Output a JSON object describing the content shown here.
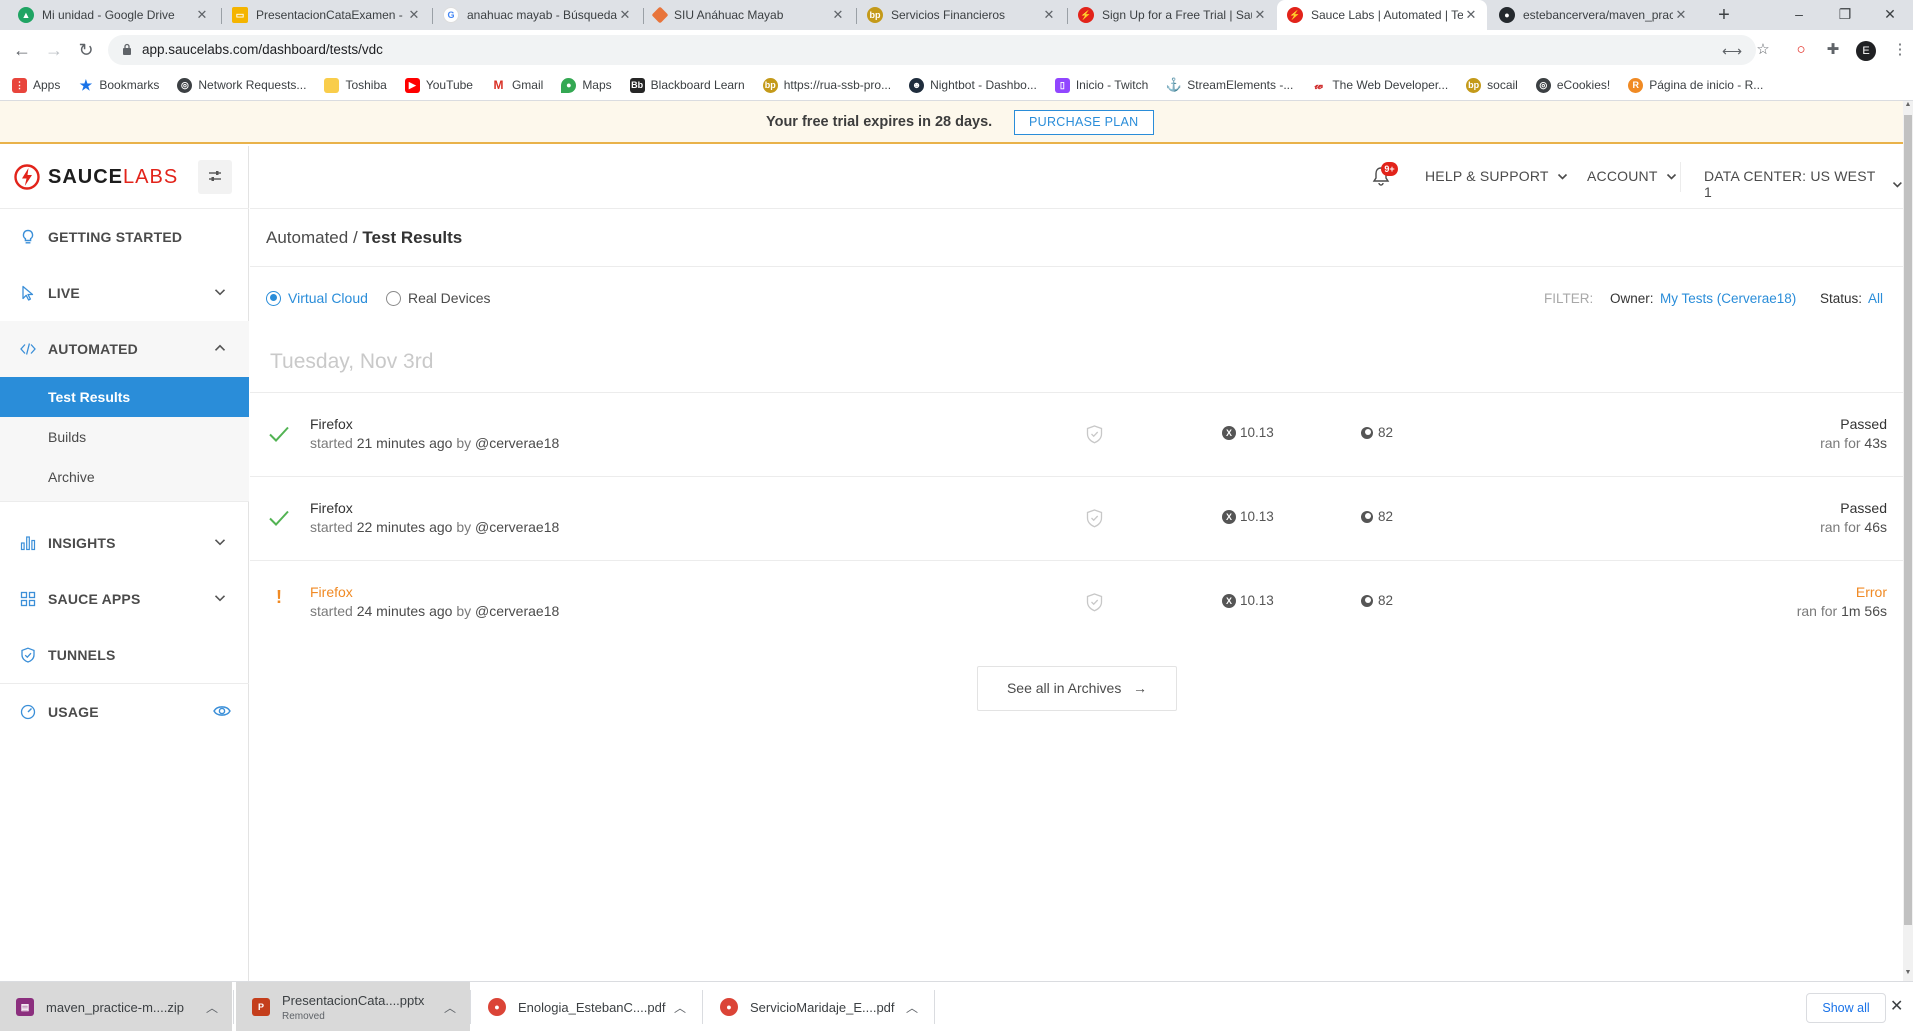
{
  "browser": {
    "tabs": [
      {
        "title": "Mi unidad - Google Drive",
        "icon": "google-drive-icon",
        "color": "#1fa463"
      },
      {
        "title": "PresentacionCataExamen - G",
        "icon": "slides-icon",
        "color": "#f4b400"
      },
      {
        "title": "anahuac mayab - Búsqueda",
        "icon": "google-icon",
        "color": "#4285f4"
      },
      {
        "title": "SIU Anáhuac Mayab",
        "icon": "siu-icon",
        "color": "#e8743b"
      },
      {
        "title": "Servicios Financieros",
        "icon": "bp-icon",
        "color": "#c49a1a"
      },
      {
        "title": "Sign Up for a Free Trial | Sau",
        "icon": "saucelabs-icon",
        "color": "#e2231a"
      },
      {
        "title": "Sauce Labs | Automated | Te",
        "icon": "saucelabs-icon",
        "color": "#e2231a"
      },
      {
        "title": "estebancervera/maven_prac",
        "icon": "github-icon",
        "color": "#24292e"
      }
    ],
    "new_tab": "+",
    "window_controls": [
      "–",
      "❐",
      "✕"
    ],
    "url": "app.saucelabs.com/dashboard/tests/vdc",
    "profile_initial": "E",
    "bookmarks": [
      {
        "label": "Apps",
        "icon": "apps-grid-icon",
        "color": "#e8453c"
      },
      {
        "label": "Bookmarks",
        "icon": "star-icon",
        "color": "#1a73e8"
      },
      {
        "label": "Network Requests...",
        "icon": "globe-icon",
        "color": "#3c4043"
      },
      {
        "label": "Toshiba",
        "icon": "folder-icon",
        "color": "#f9cd4b"
      },
      {
        "label": "YouTube",
        "icon": "youtube-icon",
        "color": "#ff0000"
      },
      {
        "label": "Gmail",
        "icon": "gmail-icon",
        "color": "#d93025"
      },
      {
        "label": "Maps",
        "icon": "maps-icon",
        "color": "#34a853"
      },
      {
        "label": "Blackboard Learn",
        "icon": "blackboard-icon",
        "color": "#262626"
      },
      {
        "label": "https://rua-ssb-pro...",
        "icon": "bp-icon",
        "color": "#c49a1a"
      },
      {
        "label": "Nightbot - Dashbo...",
        "icon": "nightbot-icon",
        "color": "#1f2d3d"
      },
      {
        "label": "Inicio - Twitch",
        "icon": "twitch-icon",
        "color": "#9146ff"
      },
      {
        "label": "StreamElements -...",
        "icon": "anchor-icon",
        "color": "#e8453c"
      },
      {
        "label": "The Web Developer...",
        "icon": "webdev-icon",
        "color": "#d02e2e"
      },
      {
        "label": "socail",
        "icon": "bp-icon",
        "color": "#c49a1a"
      },
      {
        "label": "eCookies!",
        "icon": "globe-icon",
        "color": "#3c4043"
      },
      {
        "label": "Página de inicio - R...",
        "icon": "r-icon",
        "color": "#f08a24"
      }
    ]
  },
  "trial_banner": {
    "message": "Your free trial expires in 28 days.",
    "button": "PURCHASE PLAN"
  },
  "sidebar": {
    "brand_word1": "SAUCE",
    "brand_word2": "LABS",
    "items": [
      {
        "label": "GETTING STARTED",
        "icon": "lightbulb-icon"
      },
      {
        "label": "LIVE",
        "icon": "cursor-icon"
      },
      {
        "label": "AUTOMATED",
        "icon": "code-icon"
      },
      {
        "label": "INSIGHTS",
        "icon": "bar-chart-icon"
      },
      {
        "label": "SAUCE APPS",
        "icon": "apps-icon"
      },
      {
        "label": "TUNNELS",
        "icon": "shield-icon"
      },
      {
        "label": "USAGE",
        "icon": "gauge-icon"
      }
    ],
    "automated_sub": [
      "Test Results",
      "Builds",
      "Archive"
    ]
  },
  "header": {
    "notification_badge": "9+",
    "help": "HELP & SUPPORT",
    "account": "ACCOUNT",
    "data_center": "DATA CENTER: US WEST 1"
  },
  "main": {
    "crumb_parent": "Automated /",
    "crumb_current": "Test Results",
    "radio_virtual": "Virtual Cloud",
    "radio_real": "Real Devices",
    "filter_label": "FILTER:",
    "owner_label": "Owner:",
    "owner_value": "My Tests (Cerverae18)",
    "status_label": "Status:",
    "status_value": "All",
    "date_header": "Tuesday, Nov 3rd",
    "tests": [
      {
        "browser": "Firefox",
        "started": "started",
        "ago": "21 minutes ago",
        "by": "by",
        "user": "@cerverae18",
        "os": "10.13",
        "version": "82",
        "result": "Passed",
        "ran": "ran for",
        "duration": "43s",
        "state": "passed"
      },
      {
        "browser": "Firefox",
        "started": "started",
        "ago": "22 minutes ago",
        "by": "by",
        "user": "@cerverae18",
        "os": "10.13",
        "version": "82",
        "result": "Passed",
        "ran": "ran for",
        "duration": "46s",
        "state": "passed"
      },
      {
        "browser": "Firefox",
        "started": "started",
        "ago": "24 minutes ago",
        "by": "by",
        "user": "@cerverae18",
        "os": "10.13",
        "version": "82",
        "result": "Error",
        "ran": "ran for",
        "duration": "1m 56s",
        "state": "error"
      }
    ],
    "see_all": "See all in Archives",
    "see_all_arrow": "→"
  },
  "downloads": {
    "items": [
      {
        "name": "maven_practice-m....zip",
        "sub": "",
        "icon": "winrar-icon",
        "color": "#8b2f7e"
      },
      {
        "name": "PresentacionCata....pptx",
        "sub": "Removed",
        "icon": "powerpoint-icon",
        "color": "#c43e1c"
      },
      {
        "name": "Enologia_EstebanC....pdf",
        "sub": "",
        "icon": "chrome-pdf-icon",
        "color": "#db4437"
      },
      {
        "name": "ServicioMaridaje_E....pdf",
        "sub": "",
        "icon": "chrome-pdf-icon",
        "color": "#db4437"
      }
    ],
    "show_all": "Show all"
  }
}
